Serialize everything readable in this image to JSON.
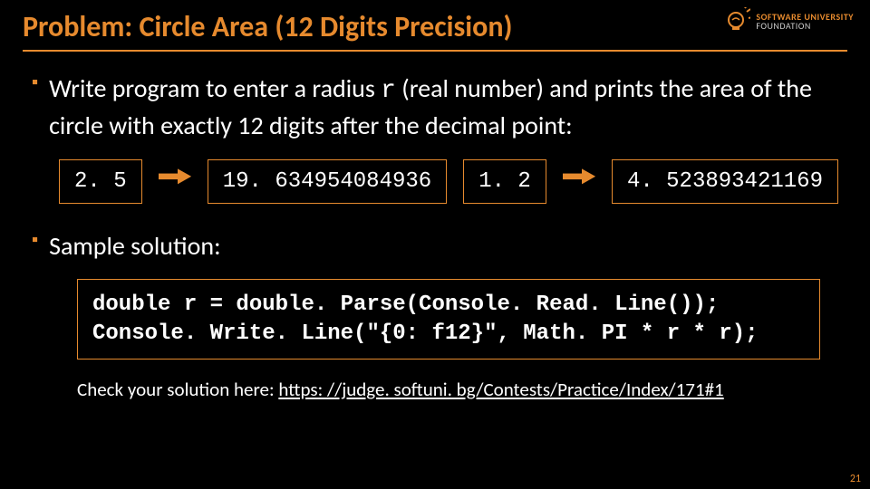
{
  "title": "Problem: Circle Area (12 Digits Precision)",
  "logo": {
    "top": "SOFTWARE UNIVERSITY",
    "bottom": "FOUNDATION"
  },
  "bullets": {
    "b1_a": "Write program to enter a radius ",
    "b1_r": "r",
    "b1_b": " (real number) and prints the area of the circle with exactly 12 digits after the decimal point:",
    "b2": "Sample solution:"
  },
  "examples": {
    "in1": "2. 5",
    "out1": "19. 634954084936",
    "in2": "1. 2",
    "out2": "4. 523893421169"
  },
  "code": "double r = double. Parse(Console. Read. Line());\nConsole. Write. Line(\"{0: f12}\", Math. PI * r * r);",
  "check": {
    "label": "Check your solution here: ",
    "url": "https: //judge. softuni. bg/Contests/Practice/Index/171#1"
  },
  "page": "21"
}
